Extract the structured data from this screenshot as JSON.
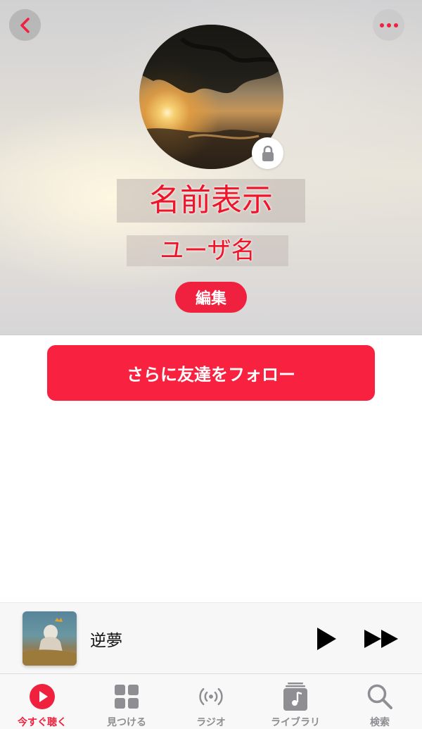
{
  "profile": {
    "display_name": "名前表示",
    "username": "ユーザ名",
    "edit_label": "編集",
    "private_lock": "lock-icon"
  },
  "actions": {
    "follow_label": "さらに友達をフォロー"
  },
  "now_playing": {
    "title": "逆夢",
    "icons": [
      "play-icon",
      "fast-forward-icon"
    ]
  },
  "tabs": [
    {
      "label": "今すぐ聴く",
      "icon": "play-circle-icon",
      "active": true
    },
    {
      "label": "見つける",
      "icon": "grid-icon",
      "active": false
    },
    {
      "label": "ラジオ",
      "icon": "radio-waves-icon",
      "active": false
    },
    {
      "label": "ライブラリ",
      "icon": "music-library-icon",
      "active": false
    },
    {
      "label": "検索",
      "icon": "search-icon",
      "active": false
    }
  ],
  "colors": {
    "accent": "#f8213f",
    "inactive_tab": "#8e8e93"
  }
}
